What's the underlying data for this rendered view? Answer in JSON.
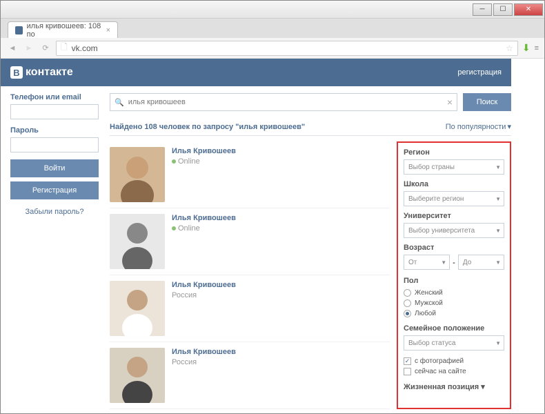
{
  "browser": {
    "tab_title": "илья кривошеев: 108 по",
    "url": "vk.com"
  },
  "header": {
    "logo_text": "контакте",
    "logo_b": "В",
    "register": "регистрация"
  },
  "login": {
    "login_label": "Телефон или email",
    "password_label": "Пароль",
    "login_btn": "Войти",
    "register_btn": "Регистрация",
    "forgot": "Забыли пароль?"
  },
  "search": {
    "query": "илья кривошеев",
    "button": "Поиск",
    "results_title": "Найдено 108 человек по запросу \"илья кривошеев\"",
    "sort": "По популярности"
  },
  "results": [
    {
      "name": "Илья Кривошеев",
      "meta": "Online",
      "online": true
    },
    {
      "name": "Илья Кривошеев",
      "meta": "Online",
      "online": true
    },
    {
      "name": "Илья Кривошеев",
      "meta": "Россия",
      "online": false
    },
    {
      "name": "Илья Кривошеев",
      "meta": "Россия",
      "online": false
    }
  ],
  "filters": {
    "region_label": "Регион",
    "region_select": "Выбор страны",
    "school_label": "Школа",
    "school_select": "Выберите регион",
    "university_label": "Университет",
    "university_select": "Выбор университета",
    "age_label": "Возраст",
    "age_from": "От",
    "age_to": "До",
    "age_sep": "-",
    "gender_label": "Пол",
    "gender_female": "Женский",
    "gender_male": "Мужской",
    "gender_any": "Любой",
    "marital_label": "Семейное положение",
    "marital_select": "Выбор статуса",
    "with_photo": "с фотографией",
    "online_now": "сейчас на сайте",
    "life_position": "Жизненная позиция"
  }
}
